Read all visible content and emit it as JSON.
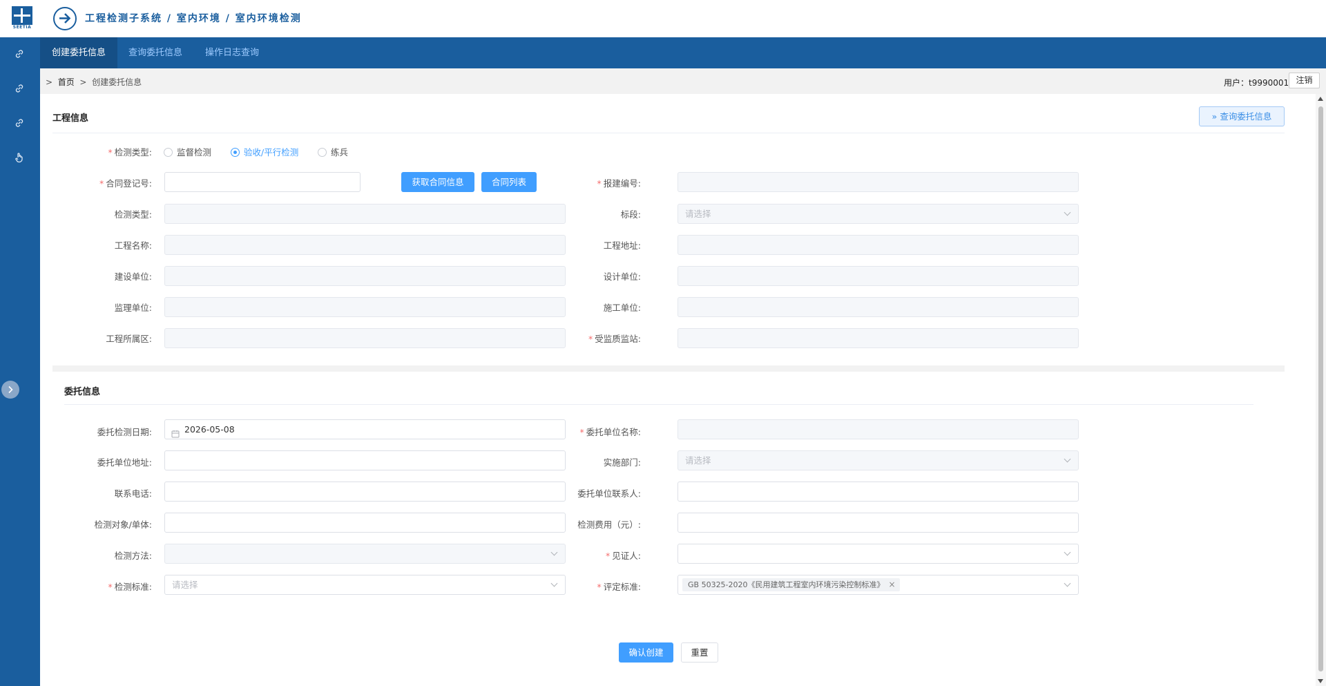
{
  "header": {
    "title": "工程检测子系统 / 室内环境 / 室内环境检测",
    "logo_text": "SEETIA"
  },
  "nav": {
    "tabs": [
      "创建委托信息",
      "查询委托信息",
      "操作日志查询"
    ]
  },
  "breadcrumb": {
    "home": "首页",
    "current": "创建委托信息",
    "sep": ">"
  },
  "user": {
    "label": "用户：t9990001",
    "logout": "注销"
  },
  "section1": {
    "title": "工程信息",
    "query_button": "查询委托信息",
    "detect_type_label": "检测类型:",
    "radios": [
      "监督检测",
      "验收/平行检测",
      "练兵"
    ],
    "contract_label": "合同登记号:",
    "btn_get_contract": "获取合同信息",
    "btn_contract_list": "合同列表",
    "report_no_label": "报建编号:",
    "detect_type2_label": "检测类型:",
    "section_label": "标段:",
    "section_placeholder": "请选择",
    "project_name_label": "工程名称:",
    "project_addr_label": "工程地址:",
    "build_unit_label": "建设单位:",
    "design_unit_label": "设计单位:",
    "supervise_unit_label": "监理单位:",
    "construct_unit_label": "施工单位:",
    "district_label": "工程所属区:",
    "quality_station_label": "受监质监站:"
  },
  "section2": {
    "title": "委托信息",
    "date_label": "委托检测日期:",
    "date_value": "2026-05-08",
    "client_name_label": "委托单位名称:",
    "client_addr_label": "委托单位地址:",
    "dept_label": "实施部门:",
    "dept_placeholder": "请选择",
    "phone_label": "联系电话:",
    "contact_label": "委托单位联系人:",
    "object_label": "检测对象/单体:",
    "fee_label": "检测费用（元）:",
    "method_label": "检测方法:",
    "witness_label": "见证人:",
    "standard_label": "检测标准:",
    "standard_placeholder": "请选择",
    "eval_label": "评定标准:",
    "eval_tag": "GB 50325-2020《民用建筑工程室内环境污染控制标准》"
  },
  "actions": {
    "confirm": "确认创建",
    "reset": "重置"
  },
  "colors": {
    "brand": "#1a5e9e",
    "primary": "#409eff",
    "required": "#f56c6c"
  }
}
